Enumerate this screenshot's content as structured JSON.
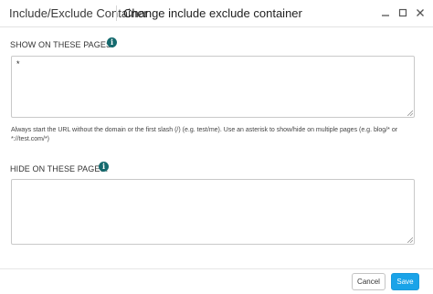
{
  "window": {
    "app_title": "Include/Exclude Container",
    "dialog_title": "Change include exclude container"
  },
  "show_section": {
    "label": "SHOW ON THESE PAGES:",
    "value": "*"
  },
  "help": {
    "text": "Always start the URL without the domain or the first slash (/) (e.g. test/me). Use an asterisk to show/hide on multiple pages (e.g. blog/* or *://test.com/*)"
  },
  "hide_section": {
    "label": "HIDE ON THESE PAGES:",
    "value": ""
  },
  "footer": {
    "cancel_label": "Cancel",
    "save_label": "Save"
  },
  "icons": {
    "info": "info-icon",
    "minimize": "minimize-icon",
    "maximize": "maximize-icon",
    "close": "close-icon"
  },
  "colors": {
    "accent": "#1aa3e8",
    "info_icon": "#156a6e"
  }
}
